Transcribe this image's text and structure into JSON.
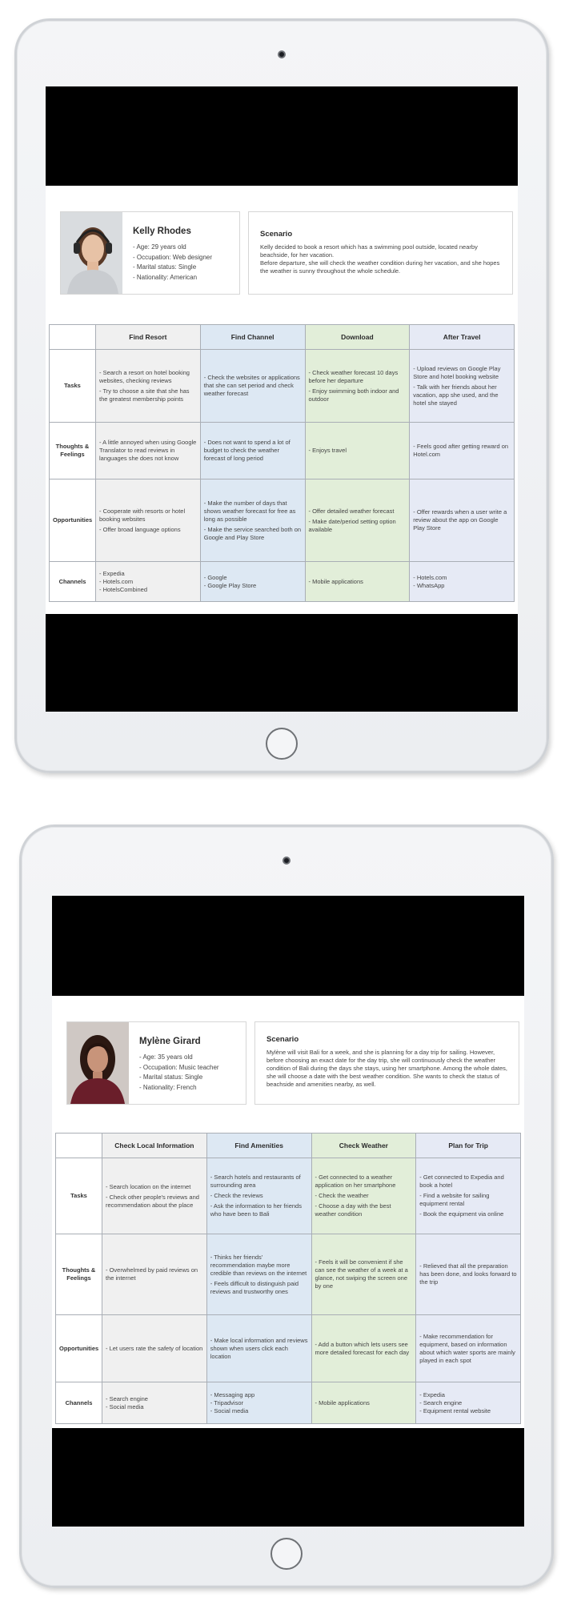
{
  "personas": [
    {
      "name": "Kelly Rhodes",
      "facts": [
        "- Age: 29 years old",
        "- Occupation: Web designer",
        "- Marital status: Single",
        "- Nationality: American"
      ],
      "scenario_title": "Scenario",
      "scenario_text": "Kelly decided to book a resort which has a swimming pool outside, located nearby beachside, for her vacation.\nBefore departure, she will check the weather condition during her vacation, and she hopes the weather is sunny throughout the whole schedule.",
      "stages": [
        "Find Resort",
        "Find Channel",
        "Download",
        "After Travel"
      ],
      "rows": [
        {
          "label": "Tasks",
          "cells": [
            [
              "- Search a resort on hotel booking websites, checking reviews",
              "- Try to choose a site that she has the greatest membership points"
            ],
            [
              "- Check the websites or applications that she can set period and check weather forecast"
            ],
            [
              "- Check weather forecast 10 days before her departure",
              "- Enjoy swimming both indoor and outdoor"
            ],
            [
              "- Upload reviews on Google Play Store and hotel booking website",
              "- Talk with her friends about her vacation, app she used, and the hotel she stayed"
            ]
          ]
        },
        {
          "label": "Thoughts & Feelings",
          "cells": [
            [
              "- A little annoyed when using Google Translator to read reviews in languages she does not know"
            ],
            [
              "- Does not want to spend a lot of budget to check the weather forecast of long period"
            ],
            [
              "- Enjoys travel"
            ],
            [
              "- Feels good after getting reward on Hotel.com"
            ]
          ]
        },
        {
          "label": "Opportunities",
          "cells": [
            [
              "- Cooperate with resorts or hotel booking websites",
              "- Offer broad language options"
            ],
            [
              "- Make the number of days that shows weather forecast for free as long as possible",
              "- Make the service searched both on Google and Play Store"
            ],
            [
              "- Offer detailed weather forecast",
              "- Make date/period setting option available"
            ],
            [
              "- Offer rewards when a user write a review about the app on Google Play Store"
            ]
          ]
        },
        {
          "label": "Channels",
          "cells": [
            [
              "- Expedia\n- Hotels.com\n- HotelsCombined"
            ],
            [
              "- Google\n- Google Play Store"
            ],
            [
              "- Mobile applications"
            ],
            [
              "- Hotels.com\n- WhatsApp"
            ]
          ]
        }
      ]
    },
    {
      "name": "Mylène Girard",
      "facts": [
        "- Age: 35 years old",
        "- Occupation: Music teacher",
        "- Marital status: Single",
        "- Nationality: French"
      ],
      "scenario_title": "Scenario",
      "scenario_text": "Mylène will visit Bali for a week, and she is planning for a day trip for sailing. However, before choosing an exact date for the day trip, she will continuously check the weather condition of Bali during the days she stays, using her smartphone. Among the whole dates, she will choose a date with the best weather condition. She wants to check the status of beachside and amenities nearby, as well.",
      "stages": [
        "Check Local Information",
        "Find Amenities",
        "Check Weather",
        "Plan for Trip"
      ],
      "rows": [
        {
          "label": "Tasks",
          "cells": [
            [
              "- Search location on the internet",
              "- Check other people's reviews and recommendation about the place"
            ],
            [
              "- Search hotels and restaurants of surrounding area",
              "- Check the reviews",
              "- Ask the information to her friends who have been to Bali"
            ],
            [
              "- Get connected to a weather application on her smartphone",
              "- Check the weather",
              "- Choose a day with the best weather condition"
            ],
            [
              "- Get connected to Expedia and book a hotel",
              "- Find a website for sailing equipment rental",
              "- Book the equipment via online"
            ]
          ]
        },
        {
          "label": "Thoughts & Feelings",
          "cells": [
            [
              "- Overwhelmed by paid reviews on the internet"
            ],
            [
              "- Thinks her friends' recommendation maybe more credible than reviews on the internet",
              "- Feels difficult to distinguish paid reviews and trustworthy ones"
            ],
            [
              "- Feels it will be convenient if she can see the weather of a week at a glance, not swiping the screen one by one"
            ],
            [
              "- Relieved that all the preparation has been done, and looks forward to the trip"
            ]
          ]
        },
        {
          "label": "Opportunities",
          "cells": [
            [
              "- Let users rate the safety of location"
            ],
            [
              "- Make local information and reviews shown when users click each location"
            ],
            [
              "- Add a button which lets users see more detailed forecast for each day"
            ],
            [
              "- Make recommendation for equipment, based on information about which water sports are mainly played in each spot"
            ]
          ]
        },
        {
          "label": "Channels",
          "cells": [
            [
              "- Search engine\n- Social media"
            ],
            [
              "- Messaging app\n- Tripadvisor\n- Social media"
            ],
            [
              "- Mobile applications"
            ],
            [
              "- Expedia\n- Search engine\n- Equipment rental website"
            ]
          ]
        }
      ]
    }
  ]
}
